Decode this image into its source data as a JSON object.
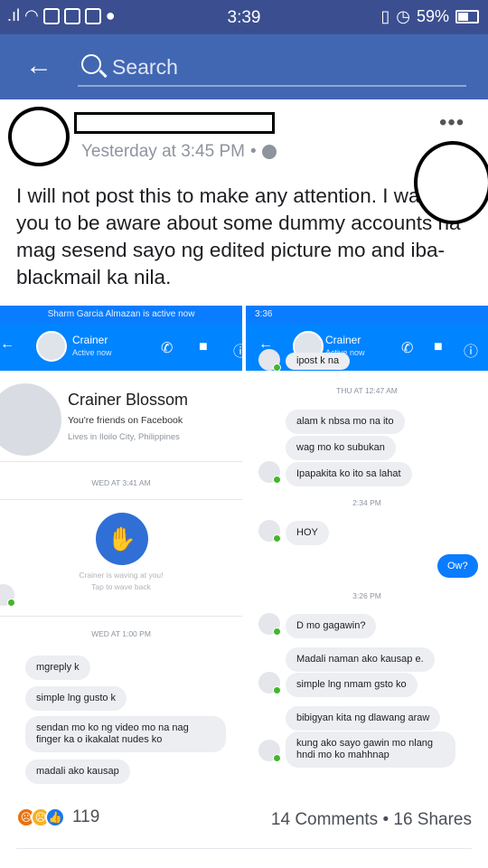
{
  "status": {
    "time": "3:39",
    "battery": "59%"
  },
  "search": {
    "placeholder": "Search"
  },
  "post": {
    "timestamp": "Yesterday at 3:45 PM",
    "separator": "•",
    "text": "I will not post this to make any attention. I want you to be aware about some dummy accounts na mag sesend sayo ng edited picture mo and iba-blackmail ka nila."
  },
  "screenshot_left": {
    "status_text": "Sharm Garcia Almazan is active now",
    "contact_name": "Crainer",
    "contact_status": "Active now",
    "profile_name": "Crainer Blossom",
    "friends_line": "You're friends on Facebook",
    "lives_line": "Lives in Iloilo City, Philippines",
    "time_1": "WED AT 3:41 AM",
    "wave_line1": "Crainer is waving at you!",
    "wave_line2": "Tap to wave back",
    "time_2": "WED AT 1:00 PM",
    "messages": [
      "mgreply k",
      "simple lng gusto k",
      "sendan mo ko ng video mo na nag finger ka o ikakalat nudes ko",
      "madali ako kausap"
    ]
  },
  "screenshot_right": {
    "status_time": "3:36",
    "contact_name": "Crainer",
    "contact_status": "Active now",
    "cut_message": "ipost k na",
    "time_1": "THU AT 12:47 AM",
    "messages_a": [
      "alam k nbsa mo na ito",
      "wag mo ko subukan",
      "Ipapakita ko ito sa lahat"
    ],
    "time_2": "2:34 PM",
    "message_hoy": "HOY",
    "my_reply": "Ow?",
    "time_3": "3:26 PM",
    "message_d": "D mo gagawin?",
    "messages_b": [
      "Madali naman ako kausap e.",
      "simple lng nmam gsto ko"
    ],
    "messages_c": [
      "bibigyan kita ng dlawang araw",
      "kung ako sayo gawin mo nlang hndi mo ko mahhnap"
    ]
  },
  "footer": {
    "reaction_count": "119",
    "comments_shares": "14 Comments • 16 Shares"
  },
  "colors": {
    "header": "#4267b2",
    "statusbar": "#3b4f90",
    "messenger_blue": "#0084ff"
  },
  "icons": [
    "wifi-icon",
    "image-icon",
    "gmail-icon",
    "mail-icon",
    "messenger-icon",
    "vibrate-icon",
    "alarm-icon",
    "battery-icon",
    "back-arrow-icon",
    "search-icon",
    "globe-icon",
    "more-icon",
    "phone-icon",
    "video-icon",
    "info-icon",
    "wave-icon",
    "angry-reaction-icon",
    "sad-reaction-icon",
    "like-reaction-icon"
  ]
}
